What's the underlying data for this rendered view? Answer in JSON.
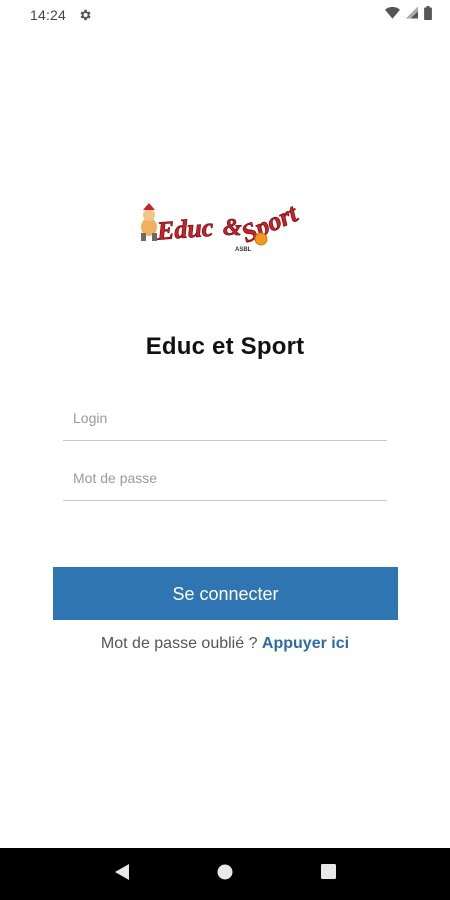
{
  "status_bar": {
    "time": "14:24",
    "settings_icon": "gear-icon",
    "wifi_icon": "wifi-icon",
    "signal_icon": "cell-signal-icon",
    "battery_icon": "battery-icon"
  },
  "logo": {
    "word1": "Educ",
    "ampersand": "&",
    "word2": "Sport",
    "tag": "ASBL"
  },
  "title": "Educ et Sport",
  "form": {
    "login_placeholder": "Login",
    "password_placeholder": "Mot de passe",
    "submit_label": "Se connecter"
  },
  "forgot": {
    "text": "Mot de passe oublié ?",
    "link": "Appuyer ici"
  },
  "nav": {
    "back_icon": "back-triangle-icon",
    "home_icon": "home-circle-icon",
    "recents_icon": "recents-square-icon"
  },
  "colors": {
    "primary": "#2e75b1",
    "link": "#2e6aa8",
    "logo_red": "#c8232b",
    "logo_orange": "#f39a1e"
  }
}
